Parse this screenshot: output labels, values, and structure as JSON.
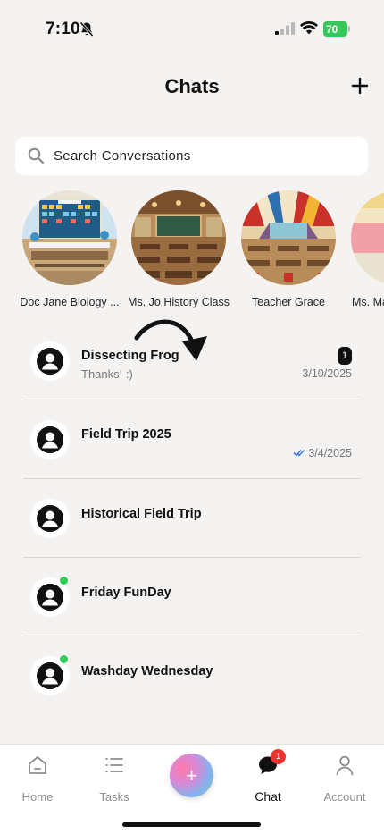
{
  "status_bar": {
    "time": "7:10",
    "battery": "70"
  },
  "header": {
    "title": "Chats",
    "add_icon": "plus-icon"
  },
  "search": {
    "placeholder": "Search Conversations"
  },
  "stories": [
    {
      "label": "Doc Jane Biology ..."
    },
    {
      "label": "Ms. Jo History Class"
    },
    {
      "label": "Teacher Grace"
    },
    {
      "label": "Ms. Ma"
    }
  ],
  "chats": [
    {
      "name": "Dissecting Frog",
      "preview": "Thanks! :)",
      "date": "3/10/2025",
      "unread": "1",
      "online": false
    },
    {
      "name": "Field Trip 2025",
      "preview": "",
      "date": "3/4/2025",
      "read": true,
      "online": false
    },
    {
      "name": "Historical Field Trip",
      "preview": "",
      "date": "",
      "online": false
    },
    {
      "name": "Friday FunDay",
      "preview": "",
      "date": "",
      "online": true
    },
    {
      "name": "Washday Wednesday",
      "preview": "",
      "date": "",
      "online": true
    }
  ],
  "nav": {
    "home": "Home",
    "tasks": "Tasks",
    "create": "+",
    "chat": "Chat",
    "chat_badge": "1",
    "account": "Account"
  },
  "colors": {
    "online": "#2ecc58",
    "badge_red": "#e8352f",
    "battery_green": "#35c759",
    "read_check": "#2f6fd6"
  }
}
